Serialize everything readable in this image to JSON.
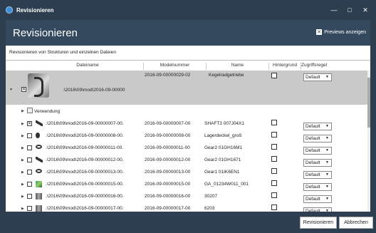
{
  "window": {
    "title": "Revisionieren",
    "minimize": "—",
    "maximize": "□",
    "close": "✕"
  },
  "header": {
    "title": "Revisionieren",
    "previews_label": "Previews anzeigen",
    "previews_checked": true
  },
  "subtitle": "Revisionieren von Strukturen und einzelnen Dateien",
  "columns": {
    "dateiname": "Dateiname",
    "modelnummer": "Modelnummer",
    "name": "Name",
    "hintergrund": "Hintergrund",
    "zugriffsregel": "Zugriffsregel"
  },
  "selected_row": {
    "path": ".\\2016\\09\\mod\\2016-09-00000",
    "modelnummer": "2016-09-00000029-02",
    "name": "Kegelradgetriebe",
    "rule": "Default",
    "checked": true
  },
  "verwendung_label": "Verwendung",
  "rows": [
    {
      "path": ".\\2016\\09\\mod\\2016-09-00000007-00.",
      "modelnummer": "2016-09-00000007-00",
      "name": "SHAFT3 007J04X1",
      "rule": "Default",
      "checked": true,
      "icon": "shaft-icon"
    },
    {
      "path": ".\\2016\\09\\mod\\2016-09-00000008-00.",
      "modelnummer": "2016-09-00000008-00",
      "name": "Lagerdeckel_groß",
      "rule": "Default",
      "checked": false,
      "icon": "cover-icon"
    },
    {
      "path": ".\\2016\\09\\mod\\2016-09-00000011-00.",
      "modelnummer": "2016-09-00000011-00",
      "name": "Gear2 01GH16M1",
      "rule": "Default",
      "checked": false,
      "icon": "gear-icon"
    },
    {
      "path": ".\\2016\\09\\mod\\2016-09-00000012-00.",
      "modelnummer": "2016-09-00000012-00",
      "name": "Gear2 01GH1671",
      "rule": "Default",
      "checked": false,
      "icon": "shaft-icon"
    },
    {
      "path": ".\\2016\\09\\mod\\2016-09-00000013-00.",
      "modelnummer": "2016-09-00000013-00",
      "name": "Gear1 01IK6EN1",
      "rule": "Default",
      "checked": false,
      "icon": "gear-icon"
    },
    {
      "path": ".\\2016\\09\\mod\\2016-09-00000015-00.",
      "modelnummer": "2016-09-00000015-00",
      "name": "GA_01234W011_001",
      "rule": "Default",
      "checked": false,
      "icon": "assembly-icon"
    },
    {
      "path": ".\\2016\\09\\mod\\2016-09-00000016-00.",
      "modelnummer": "2016-09-00000016-00",
      "name": "30207",
      "rule": "Default",
      "checked": false,
      "icon": "bearing-icon"
    },
    {
      "path": ".\\2016\\09\\mod\\2016-09-00000017-00.",
      "modelnummer": "2016-09-00000017-00",
      "name": "6203",
      "rule": "Default",
      "checked": false,
      "icon": "bearing-icon"
    }
  ],
  "buttons": {
    "revisionieren": "Revisionieren",
    "abbrechen": "Abbrechen"
  },
  "colors": {
    "titlebar": "#2c3e50",
    "header": "#34495e",
    "selected_row": "#c9c9c9"
  }
}
